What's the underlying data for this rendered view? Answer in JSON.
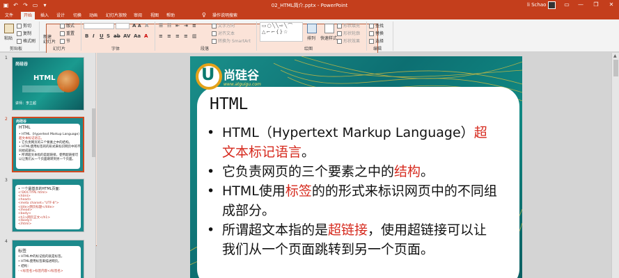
{
  "window": {
    "title": "02_HTML简介.pptx - PowerPoint",
    "user": "li Schao",
    "accent": "#c43e1c"
  },
  "tabs": [
    {
      "label": "文件",
      "active": false
    },
    {
      "label": "开始",
      "active": true
    },
    {
      "label": "插入",
      "active": false
    },
    {
      "label": "设计",
      "active": false
    },
    {
      "label": "切换",
      "active": false
    },
    {
      "label": "动画",
      "active": false
    },
    {
      "label": "幻灯片放映",
      "active": false
    },
    {
      "label": "审阅",
      "active": false
    },
    {
      "label": "视图",
      "active": false
    },
    {
      "label": "帮助",
      "active": false
    },
    {
      "label": "操作说明搜索",
      "active": false
    }
  ],
  "ribbon": {
    "clipboard": {
      "paste": "粘贴",
      "cut": "剪切",
      "copy": "复制",
      "format_painter": "格式刷",
      "label": "剪贴板"
    },
    "slides": {
      "new_slide": "新建\n幻灯片",
      "layout": "版式",
      "reset": "重置",
      "section": "节",
      "label": "幻灯片"
    },
    "font": {
      "label": "字体"
    },
    "paragraph": {
      "text_direction": "文字方向",
      "align_text": "对齐文本",
      "smartart": "转换为 SmartArt",
      "label": "段落"
    },
    "drawing": {
      "arrange": "排列",
      "quick_styles": "快速样式",
      "shape_fill": "形状填充",
      "shape_outline": "形状轮廓",
      "shape_effects": "形状效果",
      "label": "绘图"
    },
    "editing": {
      "find": "查找",
      "replace": "替换",
      "select": "选择",
      "label": "编辑"
    }
  },
  "thumbnails": [
    {
      "number": "1",
      "logo": "尚硅谷",
      "title": "HTML",
      "speaker": "讲师：李立超"
    },
    {
      "number": "2",
      "title": "HTML",
      "lines": [
        {
          "text": "• HTML（Hypertext Markup Language）",
          "red": false
        },
        {
          "text": "超文本标记语言。",
          "red": true
        },
        {
          "text": "• 它负责网页的三个要素之中的结构。",
          "red": false
        },
        {
          "text": "• HTML使用标签的的形式来标识网页中的不",
          "red": false
        },
        {
          "text": "同组成部分。",
          "red": false
        },
        {
          "text": "• 所谓超文本指的是超链接，使用超链接可",
          "red": false
        },
        {
          "text": "以让我们从一个页面跳转到另一个页面。",
          "red": false
        }
      ]
    },
    {
      "number": "3",
      "title": "• 一个最基本的HTML页面：",
      "lines": [
        {
          "text": "<!DOCTYPE html>",
          "red": true
        },
        {
          "text": "<html>",
          "red": true
        },
        {
          "text": "<head>",
          "red": true
        },
        {
          "text": "  <meta charset=\"UTF-8\">",
          "red": true
        },
        {
          "text": "  <title>网页标题</title>",
          "red": true
        },
        {
          "text": "</head>",
          "red": true
        },
        {
          "text": "<body>",
          "red": true
        },
        {
          "text": "  <h1>网页正文</h1>",
          "red": true
        },
        {
          "text": "</body>",
          "red": true
        },
        {
          "text": "</html>",
          "red": true
        }
      ]
    },
    {
      "number": "4",
      "title": "标签",
      "lines": [
        {
          "text": "• HTML中的标记指的就是标签。",
          "red": false
        },
        {
          "text": "• HTML使用标签来描述网页。",
          "red": false
        },
        {
          "text": "• 结构：",
          "red": false
        },
        {
          "text": "  - <标签名>标签内容</标签名>",
          "red": false
        }
      ]
    }
  ],
  "slide": {
    "logo_name": "尚硅谷",
    "logo_url": "www.atguigu.com",
    "title": "HTML",
    "bullets": [
      {
        "parts": [
          {
            "text": "HTML（Hypertext Markup Language）",
            "red": false
          },
          {
            "text": "超文本标记语言",
            "red": true
          },
          {
            "text": "。",
            "red": false
          }
        ]
      },
      {
        "parts": [
          {
            "text": "它负责网页的三个要素之中的",
            "red": false
          },
          {
            "text": "结构",
            "red": true
          },
          {
            "text": "。",
            "red": false
          }
        ]
      },
      {
        "parts": [
          {
            "text": "HTML使用",
            "red": false
          },
          {
            "text": "标签",
            "red": true
          },
          {
            "text": "的的形式来标识网页中的不同组成部分。",
            "red": false
          }
        ]
      },
      {
        "parts": [
          {
            "text": "所谓超文本指的是",
            "red": false
          },
          {
            "text": "超链接",
            "red": true
          },
          {
            "text": "，使用超链接可以让我们从一个页面跳转到另一个页面。",
            "red": false
          }
        ]
      }
    ],
    "highlight_color": "#d62a1e"
  }
}
